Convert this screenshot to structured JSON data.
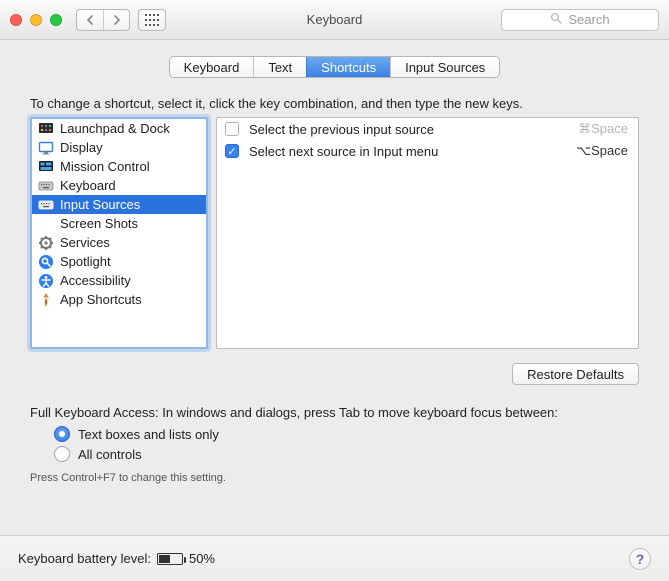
{
  "window": {
    "title": "Keyboard",
    "search_placeholder": "Search"
  },
  "tabs": [
    {
      "id": "keyboard",
      "label": "Keyboard",
      "active": false
    },
    {
      "id": "text",
      "label": "Text",
      "active": false
    },
    {
      "id": "shortcuts",
      "label": "Shortcuts",
      "active": true
    },
    {
      "id": "input-sources",
      "label": "Input Sources",
      "active": false
    }
  ],
  "instruction": "To change a shortcut, select it, click the key combination, and then type the new keys.",
  "categories": [
    {
      "id": "launchpad",
      "label": "Launchpad & Dock",
      "icon": "launchpad",
      "selected": false
    },
    {
      "id": "display",
      "label": "Display",
      "icon": "display",
      "selected": false
    },
    {
      "id": "mission-control",
      "label": "Mission Control",
      "icon": "mission-control",
      "selected": false
    },
    {
      "id": "keyboard",
      "label": "Keyboard",
      "icon": "keyboard",
      "selected": false
    },
    {
      "id": "input-sources",
      "label": "Input Sources",
      "icon": "input-sources",
      "selected": true
    },
    {
      "id": "screen-shots",
      "label": "Screen Shots",
      "icon": "screenshot",
      "selected": false
    },
    {
      "id": "services",
      "label": "Services",
      "icon": "gear",
      "selected": false
    },
    {
      "id": "spotlight",
      "label": "Spotlight",
      "icon": "spotlight",
      "selected": false
    },
    {
      "id": "accessibility",
      "label": "Accessibility",
      "icon": "accessibility",
      "selected": false
    },
    {
      "id": "app-shortcuts",
      "label": "App Shortcuts",
      "icon": "app-shortcuts",
      "selected": false
    }
  ],
  "shortcuts": [
    {
      "enabled": false,
      "label": "Select the previous input source",
      "keys": "⌘Space",
      "enabled_dim": true
    },
    {
      "enabled": true,
      "label": "Select next source in Input menu",
      "keys": "⌥Space",
      "enabled_dim": false
    }
  ],
  "restore_label": "Restore Defaults",
  "kb_access": {
    "intro": "Full Keyboard Access: In windows and dialogs, press Tab to move keyboard focus between:",
    "options": [
      {
        "id": "text-boxes",
        "label": "Text boxes and lists only",
        "selected": true
      },
      {
        "id": "all-controls",
        "label": "All controls",
        "selected": false
      }
    ],
    "hint": "Press Control+F7 to change this setting."
  },
  "footer": {
    "battery_label": "Keyboard battery level:",
    "battery_pct": "50%",
    "battery_fill_pct": 50
  }
}
